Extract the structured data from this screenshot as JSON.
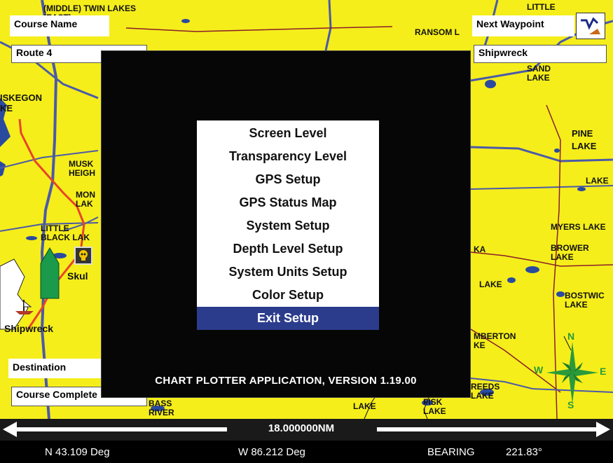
{
  "header": {
    "course_name_label": "Course Name",
    "course_name_value": "Route 4",
    "next_waypoint_label": "Next Waypoint",
    "next_waypoint_value": "Shipwreck"
  },
  "footer_panel": {
    "destination_label": "Destination",
    "destination_value": "Course Complete"
  },
  "map": {
    "labels": {
      "twin_lakes": "(MIDDLE) TWIN LAKES\n(EAST)",
      "little": "LITTLE",
      "ransom": "RANSOM L",
      "sand_lake": "SAND\nLAKE",
      "pine_lake": "PINE\nLAKE",
      "muskegon": "ISKEGON\nKE",
      "musk_heights": "MUSK\nHEIGH",
      "mon_lake": "MON\nLAK",
      "little_black_lake": "LITTLE\nBLACK LAK",
      "skull": "Skul",
      "shipwreck_wp": "Shipwreck",
      "lake_2n": "LAKE",
      "myers_lake": "MYERS LAKE",
      "brower_lake": "BROWER\nLAKE",
      "ka": "KA",
      "lake_mid": "LAKE",
      "bostwick_lake": "BOSTWIC\nLAKE",
      "mberton": "MBERTON\nKE",
      "bass_river": "BASS\nRIVER",
      "lake_bottom": "LAKE",
      "fisk_lake": "FISK\nLAKE",
      "reeds_lake": "REEDS\nLAKE"
    },
    "compass": {
      "n": "N",
      "s": "S",
      "e": "E",
      "w": "W"
    }
  },
  "setup_menu": {
    "items": [
      "Screen Level",
      "Transparency Level",
      "GPS Setup",
      "GPS Status Map",
      "System Setup",
      "Depth Level Setup",
      "System Units Setup",
      "Color Setup",
      "Exit Setup"
    ],
    "selected": "Exit Setup",
    "version_text": "CHART PLOTTER APPLICATION, VERSION 1.19.00"
  },
  "scale": {
    "value": "18.000000NM"
  },
  "status": {
    "latitude": "N  43.109 Deg",
    "longitude": "W  86.212 Deg",
    "bearing_label": "BEARING",
    "bearing_value": "221.83°"
  },
  "icons": {
    "waypoint_icon": "navigate-to-waypoint-icon",
    "boat": "boat-position-icon",
    "skull": "skull-waypoint-icon",
    "compass": "compass-rose-icon"
  },
  "colors": {
    "map_land": "#f5ee1a",
    "road": "#4b5aa8",
    "route": "#e8442a",
    "water": "#2a4aa0",
    "menu_selected": "#2c3c8c",
    "boat": "#1a9a4a",
    "compass": "#2a9a3a"
  }
}
